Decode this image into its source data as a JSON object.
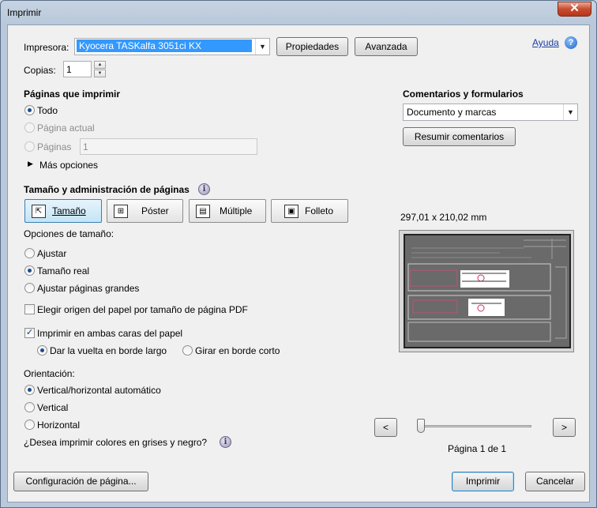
{
  "window": {
    "title": "Imprimir",
    "close_glyph": "✕"
  },
  "help": {
    "label": "Ayuda",
    "icon": "help-icon",
    "glyph": "?"
  },
  "printer": {
    "label": "Impresora:",
    "selected": "Kyocera TASKalfa 3051ci KX",
    "properties_button": "Propiedades",
    "advanced_button": "Avanzada"
  },
  "copies": {
    "label": "Copias:",
    "value": "1"
  },
  "pages": {
    "heading": "Páginas que imprimir",
    "all": "Todo",
    "current": "Página actual",
    "range": "Páginas",
    "range_value": "1",
    "more_options": "Más opciones",
    "selected": "all"
  },
  "comments": {
    "heading": "Comentarios y formularios",
    "selected": "Documento y marcas",
    "summarize_button": "Resumir comentarios"
  },
  "sizing": {
    "heading": "Tamaño y administración de páginas",
    "tabs": [
      {
        "label": "Tamaño",
        "icon": "size-icon",
        "glyph": "⇱"
      },
      {
        "label": "Póster",
        "icon": "poster-icon",
        "glyph": "⊞"
      },
      {
        "label": "Múltiple",
        "icon": "multiple-icon",
        "glyph": "▤"
      },
      {
        "label": "Folleto",
        "icon": "booklet-icon",
        "glyph": "▣"
      }
    ],
    "options_label": "Opciones de tamaño:",
    "fit": "Ajustar",
    "actual": "Tamaño real",
    "shrink": "Ajustar páginas grandes",
    "selected": "actual",
    "choose_paper": "Elegir origen del papel por tamaño de página PDF",
    "duplex": "Imprimir en ambas caras del papel",
    "flip_long": "Dar la vuelta en borde largo",
    "flip_short": "Girar en borde corto"
  },
  "orientation": {
    "label": "Orientación:",
    "auto": "Vertical/horizontal automático",
    "portrait": "Vertical",
    "landscape": "Horizontal",
    "selected": "auto"
  },
  "grayscale_question": "¿Desea imprimir colores en grises y negro?",
  "preview": {
    "dimensions": "297,01 x 210,02 mm",
    "prev_glyph": "<",
    "next_glyph": ">",
    "page_status": "Página 1 de 1"
  },
  "footer": {
    "page_setup_button": "Configuración de página...",
    "print_button": "Imprimir",
    "cancel_button": "Cancelar"
  },
  "colors": {
    "accent": "#3c7fb1",
    "selection": "#3399ff",
    "title_bg": "#b9c8da"
  }
}
